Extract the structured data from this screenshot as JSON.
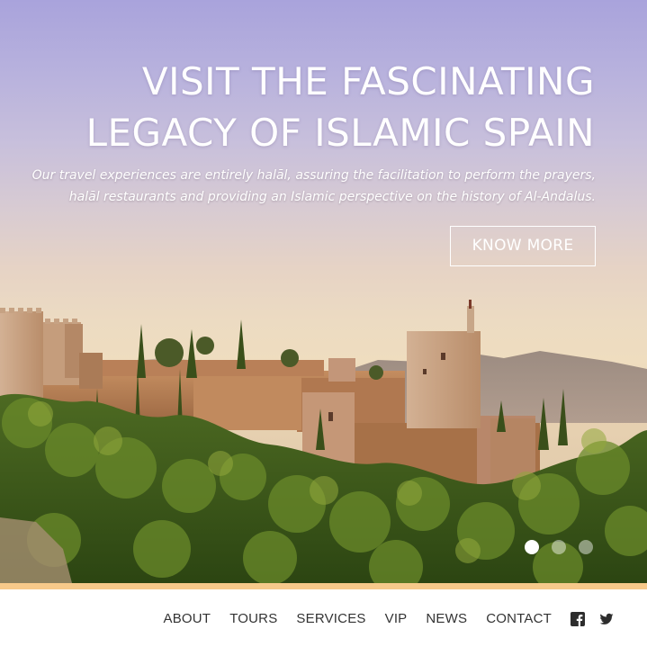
{
  "hero": {
    "headline_line1": "VISIT THE FASCINATING",
    "headline_line2": "LEGACY OF ISLAMIC SPAIN",
    "subtitle_line1": "Our travel experiences are entirely halāl, assuring the facilitation to perform the prayers,",
    "subtitle_line2": "halāl restaurants and providing an Islamic perspective on the history of  Al-Andalus.",
    "cta_label": "KNOW MORE",
    "image_subject": "alhambra-fortress-photo",
    "carousel": {
      "total_slides": 3,
      "active_index": 0
    }
  },
  "nav": {
    "items": [
      {
        "label": "ABOUT"
      },
      {
        "label": "TOURS"
      },
      {
        "label": "SERVICES"
      },
      {
        "label": "VIP"
      },
      {
        "label": "NEWS"
      },
      {
        "label": "CONTACT"
      }
    ],
    "social": [
      {
        "icon": "facebook-icon"
      },
      {
        "icon": "twitter-icon"
      }
    ]
  },
  "colors": {
    "accent_bar": "#f6c98a",
    "nav_text": "#333333",
    "sky_top": "#a9a3dc",
    "sky_bottom": "#efddbf"
  }
}
